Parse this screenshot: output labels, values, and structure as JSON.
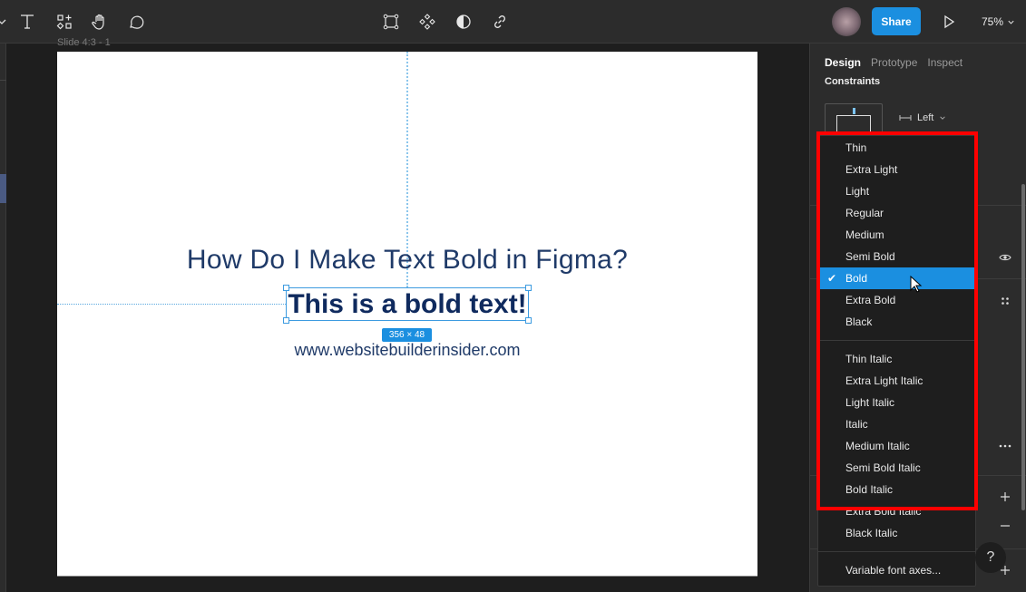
{
  "toolbar": {
    "left_tools": [
      {
        "name": "text-tool",
        "icon": "text-icon"
      },
      {
        "name": "resources-tool",
        "icon": "resources-icon"
      },
      {
        "name": "hand-tool",
        "icon": "hand-icon"
      },
      {
        "name": "comment-tool",
        "icon": "comment-icon"
      }
    ],
    "center_tools": [
      {
        "name": "frame-selection-tool",
        "icon": "frame-selection-icon"
      },
      {
        "name": "component-tool",
        "icon": "component-icon"
      },
      {
        "name": "contrast-tool",
        "icon": "contrast-icon"
      },
      {
        "name": "link-tool",
        "icon": "link-icon"
      }
    ],
    "share_label": "Share",
    "zoom_level": "75%",
    "colors": {
      "accent": "#1b8fe0",
      "toolbar_bg": "#2c2c2c"
    }
  },
  "canvas": {
    "frame_label": "Slide 4:3 - 1",
    "heading": "How Do I Make Text Bold in Figma?",
    "bold_text": "This is a bold text!",
    "dimension_badge": "356 × 48",
    "url_text": "www.websitebuilderinsider.com",
    "colors": {
      "text": "#1f3a68",
      "bold_text": "#0f2a5e",
      "selection": "#3d9be0"
    }
  },
  "panel": {
    "tabs": [
      {
        "label": "Design",
        "active": true
      },
      {
        "label": "Prototype",
        "active": false
      },
      {
        "label": "Inspect",
        "active": false
      }
    ],
    "constraints_label": "Constraints",
    "horizontal_constraint": "Left"
  },
  "font_weight_menu": {
    "selected": "Bold",
    "upright": [
      "Thin",
      "Extra Light",
      "Light",
      "Regular",
      "Medium",
      "Semi Bold",
      "Bold",
      "Extra Bold",
      "Black"
    ],
    "italic": [
      "Thin Italic",
      "Extra Light Italic",
      "Light Italic",
      "Italic",
      "Medium Italic",
      "Semi Bold Italic",
      "Bold Italic",
      "Extra Bold Italic",
      "Black Italic"
    ],
    "footer": "Variable font axes...",
    "highlight_color": "#ff0000"
  },
  "help_label": "?"
}
